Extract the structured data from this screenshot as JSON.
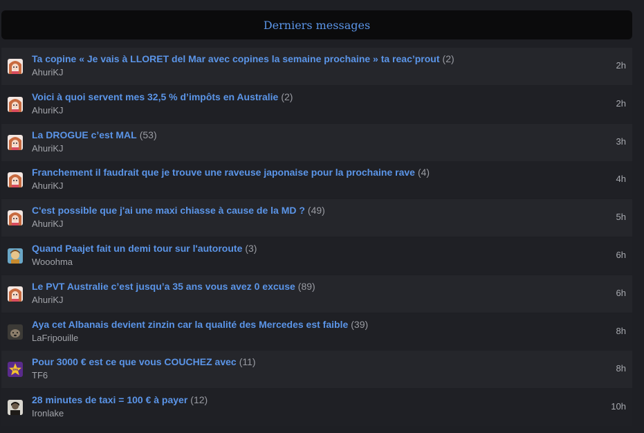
{
  "header": {
    "title": "Derniers messages"
  },
  "topics": [
    {
      "title": "Ta copine « Je vais à LLORET del Mar avec copines la semaine prochaine » ta reac’prout",
      "count": "(2)",
      "author": "AhuriKJ",
      "time": "2h",
      "avatar": "anime-girl-avatar"
    },
    {
      "title": "Voici à quoi servent mes 32,5 % d’impôts en Australie",
      "count": "(2)",
      "author": "AhuriKJ",
      "time": "2h",
      "avatar": "anime-girl-avatar"
    },
    {
      "title": "La DROGUE c’est MAL",
      "count": "(53)",
      "author": "AhuriKJ",
      "time": "3h",
      "avatar": "anime-girl-avatar"
    },
    {
      "title": "Franchement il faudrait que je trouve une raveuse japonaise pour la prochaine rave",
      "count": "(4)",
      "author": "AhuriKJ",
      "time": "4h",
      "avatar": "anime-girl-avatar"
    },
    {
      "title": "C'est possible que j'ai une maxi chiasse à cause de la MD ?",
      "count": "(49)",
      "author": "AhuriKJ",
      "time": "5h",
      "avatar": "anime-girl-avatar"
    },
    {
      "title": "Quand Paajet fait un demi tour sur l'autoroute",
      "count": "(3)",
      "author": "Wooohma",
      "time": "6h",
      "avatar": "cartoon-avatar"
    },
    {
      "title": "Le PVT Australie c’est jusqu’a 35 ans vous avez 0 excuse",
      "count": "(89)",
      "author": "AhuriKJ",
      "time": "6h",
      "avatar": "anime-girl-avatar"
    },
    {
      "title": "Aya cet Albanais devient zinzin car la qualité des Mercedes est faible",
      "count": "(39)",
      "author": "LaFripouille",
      "time": "8h",
      "avatar": "animal-avatar"
    },
    {
      "title": "Pour 3000 € est ce que vous COUCHEZ avec",
      "count": "(11)",
      "author": "TF6",
      "time": "8h",
      "avatar": "purple-star-avatar"
    },
    {
      "title": "28 minutes de taxi = 100 € à payer",
      "count": "(12)",
      "author": "Ironlake",
      "time": "10h",
      "avatar": "dark-portrait-avatar"
    }
  ]
}
